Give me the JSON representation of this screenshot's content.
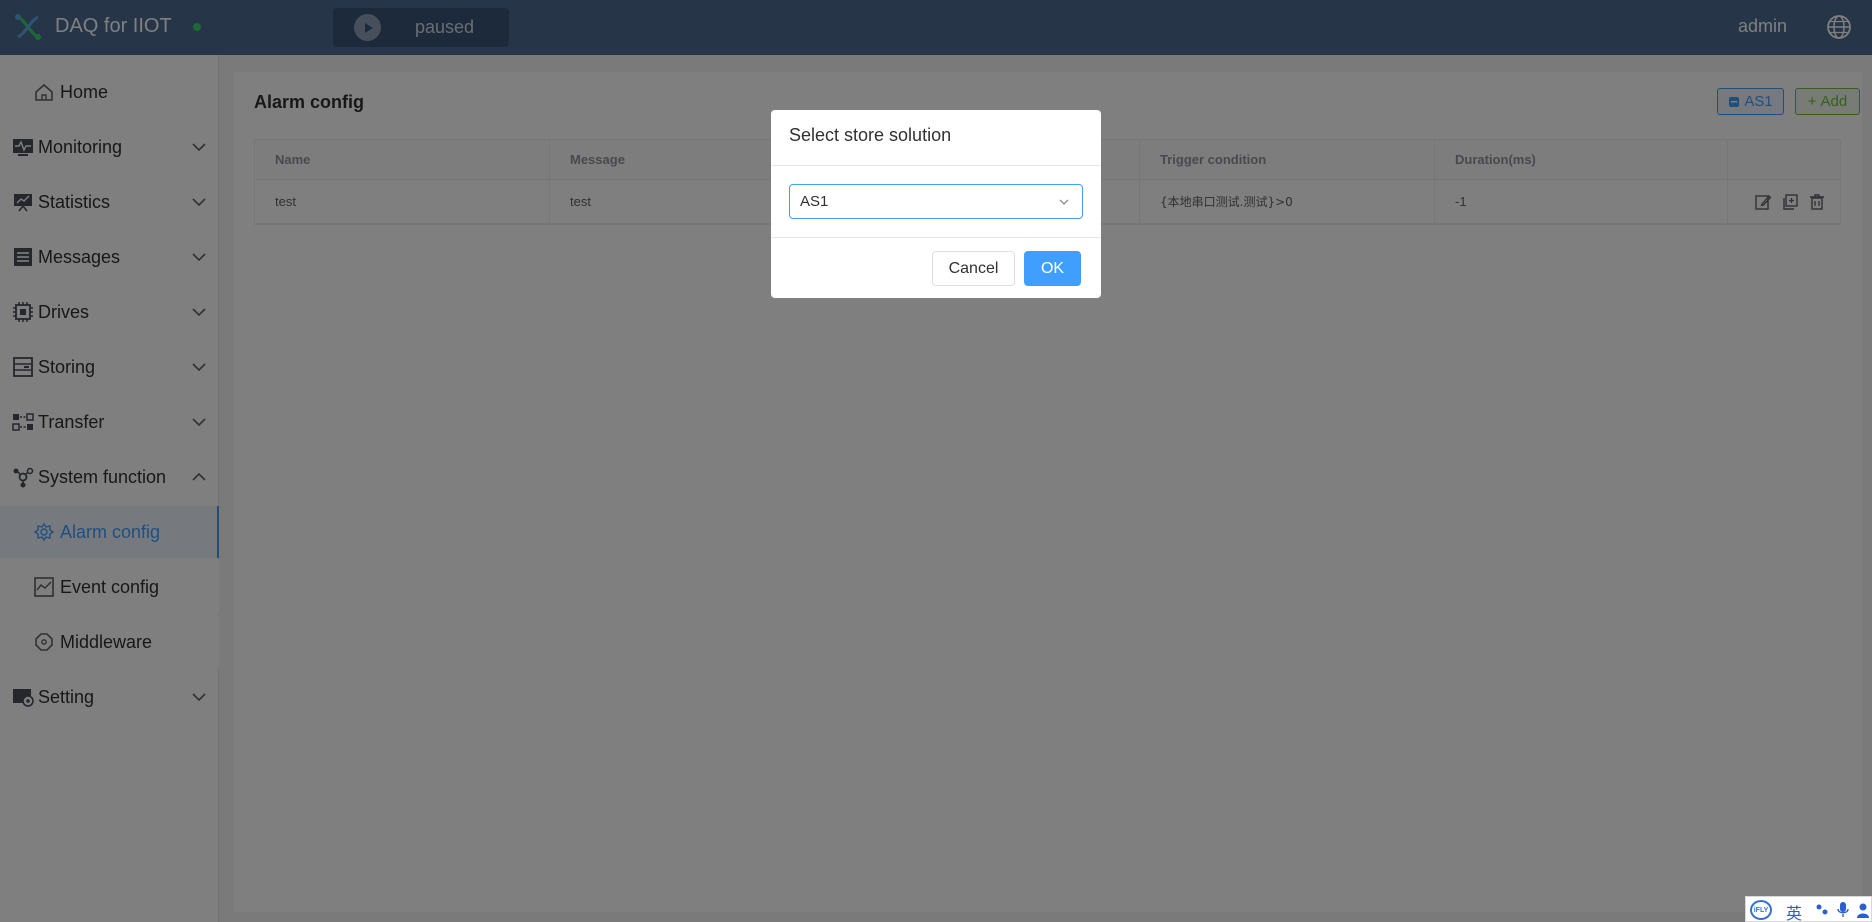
{
  "header": {
    "app_title": "DAQ for IIOT",
    "run_status": "paused",
    "user": "admin"
  },
  "sidebar": {
    "items": [
      {
        "label": "Home",
        "icon": "home-icon"
      },
      {
        "label": "Monitoring",
        "icon": "monitor-icon"
      },
      {
        "label": "Statistics",
        "icon": "statistics-icon"
      },
      {
        "label": "Messages",
        "icon": "messages-icon"
      },
      {
        "label": "Drives",
        "icon": "chip-icon"
      },
      {
        "label": "Storing",
        "icon": "storage-icon"
      },
      {
        "label": "Transfer",
        "icon": "transfer-icon"
      },
      {
        "label": "System function",
        "icon": "system-icon"
      },
      {
        "label": "Setting",
        "icon": "setting-icon"
      }
    ],
    "sub_items": [
      {
        "label": "Alarm config",
        "icon": "alarm-config-icon",
        "active": true
      },
      {
        "label": "Event config",
        "icon": "event-config-icon"
      },
      {
        "label": "Middleware",
        "icon": "middleware-icon"
      }
    ]
  },
  "main": {
    "title": "Alarm config",
    "as1_button": "AS1",
    "add_button": "Add",
    "table": {
      "columns": [
        "Name",
        "Message",
        "",
        "Trigger condition",
        "Duration(ms)",
        ""
      ],
      "rows": [
        {
          "name": "test",
          "message": "test",
          "col3": "",
          "trigger": "{本地串口测试.测试}>0",
          "duration": "-1"
        }
      ]
    }
  },
  "dialog": {
    "title": "Select store solution",
    "selected": "AS1",
    "cancel": "Cancel",
    "ok": "OK"
  },
  "ime": {
    "logo": "iFLY",
    "lang": "英"
  },
  "colors": {
    "header_bg": "#4d6a91",
    "primary": "#409eff",
    "success": "#67c23a",
    "status_dot": "#3bd36b"
  }
}
